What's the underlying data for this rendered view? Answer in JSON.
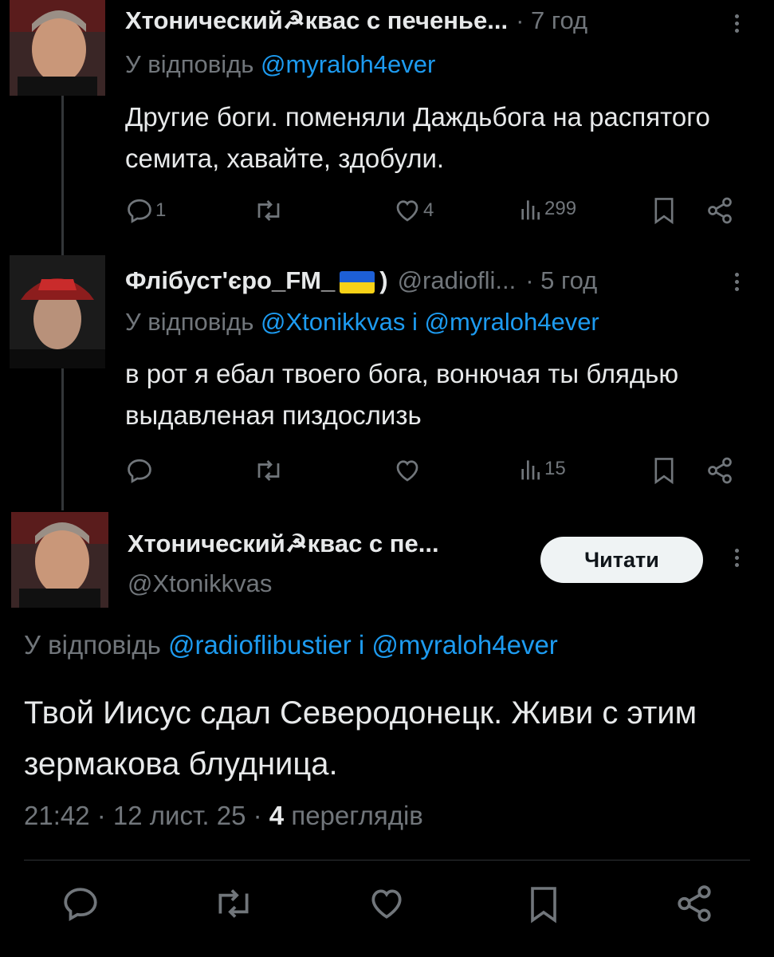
{
  "tweets": [
    {
      "name": "Хтонический☭квас с печенье...",
      "time": "· 7 год",
      "reply_prefix": "У відповідь ",
      "mentions": "@myraloh4ever",
      "text": "Другие боги. поменяли Даждьбога на распятого семита, хавайте, здобули.",
      "replies": "1",
      "retweets": "",
      "likes": "4",
      "views": "299"
    },
    {
      "name_prefix": "Флібуст'єро_FM_",
      "name_suffix": ")",
      "handle": "@radiofli...",
      "time": "· 5 год",
      "reply_prefix": "У відповідь ",
      "mentions": "@Xtonikkvas і @myraloh4ever",
      "text": "в рот я ебал твоего бога, вонючая ты блядью выдавленая пиздослизь",
      "replies": "",
      "retweets": "",
      "likes": "",
      "views": "15"
    }
  ],
  "main": {
    "name": "Хтонический☭квас с пе...",
    "handle": "@Xtonikkvas",
    "follow_label": "Читати",
    "reply_prefix": "У відповідь ",
    "mentions": "@radioflibustier і @myraloh4ever",
    "text": "Твой Иисус сдал Северодонецк. Живи с этим зермакова блудница.",
    "time": "21:42 · 12 лист. 25 · ",
    "views_count": "4",
    "views_label": " переглядів"
  },
  "icons": [
    "reply-icon",
    "retweet-icon",
    "like-icon",
    "views-icon",
    "bookmark-icon",
    "share-icon",
    "more-icon"
  ],
  "colors": {
    "background": "#000000",
    "text": "#e7e9ea",
    "muted": "#71767b",
    "link": "#1d9bf0",
    "button": "#eff3f4"
  }
}
